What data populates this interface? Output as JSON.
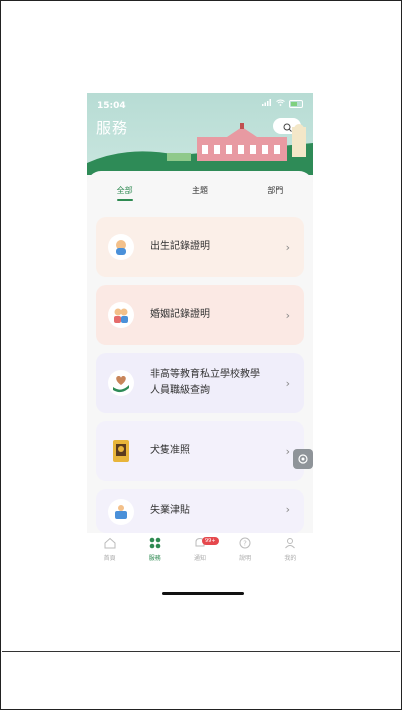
{
  "status_bar": {
    "time": "15:04"
  },
  "header": {
    "title": "服務"
  },
  "tabs": [
    {
      "label": "全部",
      "active": true
    },
    {
      "label": "主題",
      "active": false
    },
    {
      "label": "部門",
      "active": false
    }
  ],
  "services": [
    {
      "label": "出生記錄證明",
      "icon": "baby-icon"
    },
    {
      "label": "婚姻記錄證明",
      "icon": "couple-icon"
    },
    {
      "label_line1": "非高等教育私立學校教學",
      "label_line2": "人員職級查詢",
      "icon": "teacher-icon"
    },
    {
      "label": "犬隻准照",
      "icon": "dog-license-icon"
    },
    {
      "label": "失業津貼",
      "icon": "unemployment-icon"
    }
  ],
  "bottom_nav": [
    {
      "label": "首頁",
      "icon": "home-icon"
    },
    {
      "label": "服務",
      "icon": "services-icon",
      "active": true
    },
    {
      "label": "通知",
      "icon": "notification-icon",
      "badge": "99+"
    },
    {
      "label": "說明",
      "icon": "help-icon"
    },
    {
      "label": "我的",
      "icon": "profile-icon"
    }
  ],
  "colors": {
    "accent": "#2f8a52",
    "header_bg": "#b7dcd4",
    "badge": "#e5484d",
    "building": "#e89aa2"
  }
}
